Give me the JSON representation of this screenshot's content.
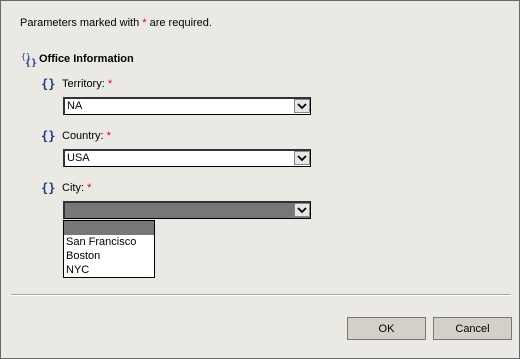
{
  "header": {
    "note_prefix": "Parameters marked with ",
    "note_star": "*",
    "note_suffix": " are required."
  },
  "section": {
    "title": "Office Information",
    "icon": "parameter-group-icon"
  },
  "fields": [
    {
      "label": "Territory:",
      "required_star": "*",
      "value": "NA",
      "icon": "parameter-braces-icon"
    },
    {
      "label": "Country:",
      "required_star": "*",
      "value": "USA",
      "icon": "parameter-braces-icon"
    },
    {
      "label": "City:",
      "required_star": "*",
      "value": "",
      "icon": "parameter-braces-icon"
    }
  ],
  "city_options": [
    "San Francisco",
    "Boston",
    "NYC"
  ],
  "buttons": {
    "ok": "OK",
    "cancel": "Cancel"
  },
  "colors": {
    "required": "#e00000",
    "icon_blue": "#1a3c8c"
  }
}
